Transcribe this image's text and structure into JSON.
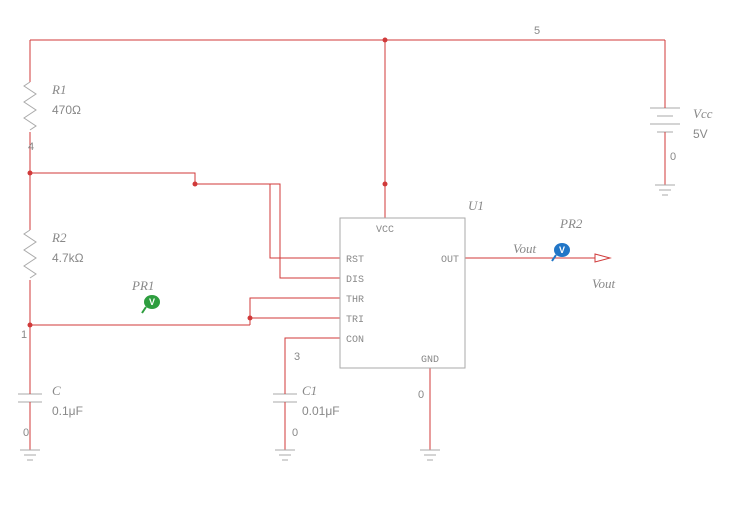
{
  "chart_data": {
    "type": "table",
    "title": "555 Timer Astable Schematic",
    "components": [
      {
        "ref": "U1",
        "type": "555",
        "pins": [
          "VCC",
          "RST",
          "DIS",
          "THR",
          "TRI",
          "CON",
          "GND",
          "OUT"
        ]
      },
      {
        "ref": "R1",
        "type": "resistor",
        "value": "470Ω"
      },
      {
        "ref": "R2",
        "type": "resistor",
        "value": "4.7kΩ"
      },
      {
        "ref": "C",
        "type": "capacitor",
        "value": "0.1μF"
      },
      {
        "ref": "C1",
        "type": "capacitor",
        "value": "0.01μF"
      },
      {
        "ref": "Vcc",
        "type": "dc_source",
        "value": "5V"
      }
    ],
    "probes": [
      {
        "ref": "PR1",
        "color": "green",
        "net": "THR/TRI node"
      },
      {
        "ref": "PR2",
        "color": "blue",
        "net": "Vout"
      }
    ],
    "nets": {
      "top_rail": "5",
      "r1_bottom": "4",
      "thr_tri": "1",
      "con": "3",
      "gnd": "0"
    },
    "output": "Vout"
  },
  "labels": {
    "R1": {
      "name": "R1",
      "value": "470Ω"
    },
    "R2": {
      "name": "R2",
      "value": "4.7kΩ"
    },
    "C": {
      "name": "C",
      "value": "0.1μF"
    },
    "C1": {
      "name": "C1",
      "value": "0.01μF"
    },
    "Vcc": {
      "name": "Vcc",
      "value": "5V"
    },
    "U1": {
      "name": "U1"
    },
    "PR1": {
      "name": "PR1"
    },
    "PR2": {
      "name": "PR2"
    },
    "Vout": {
      "name": "Vout"
    },
    "Vout2": {
      "name": "Vout"
    }
  },
  "pins": {
    "vcc": "VCC",
    "rst": "RST",
    "dis": "DIS",
    "thr": "THR",
    "tri": "TRI",
    "con": "CON",
    "gnd": "GND",
    "out": "OUT"
  },
  "nets": {
    "n5": "5",
    "n4": "4",
    "n1": "1",
    "n3": "3",
    "n0a": "0",
    "n0b": "0",
    "n0c": "0",
    "n0d": "0"
  },
  "probeGlyph": "V"
}
